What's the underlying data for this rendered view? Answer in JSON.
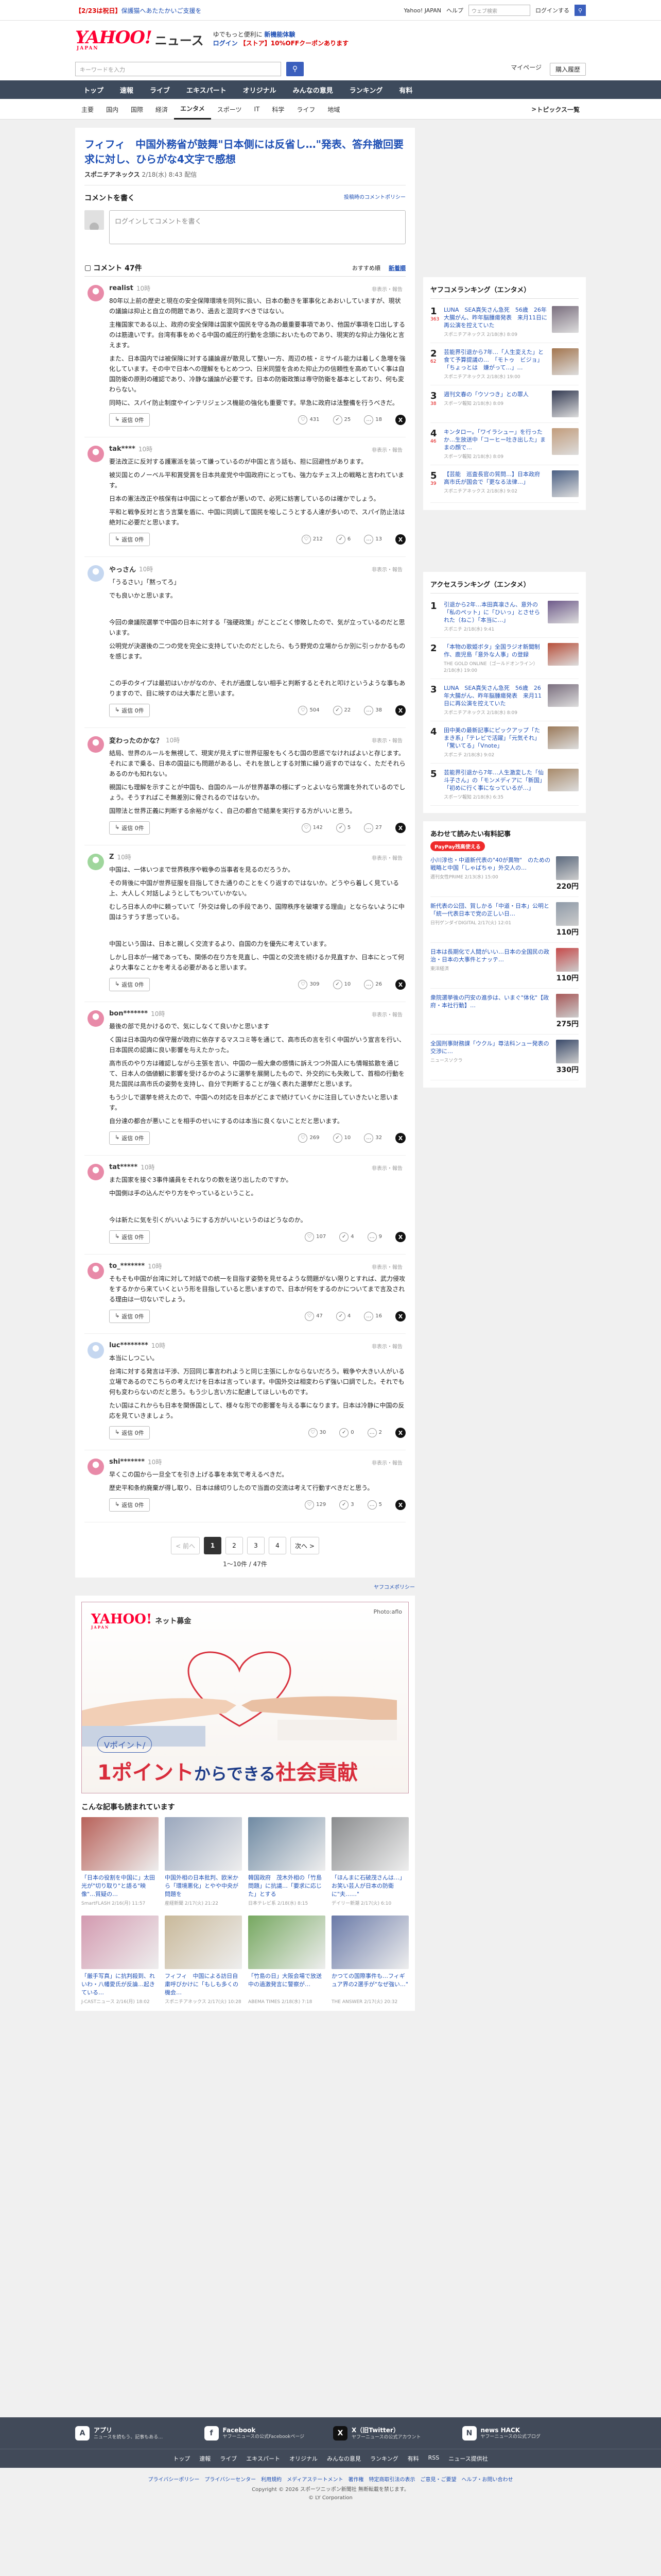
{
  "topstrip": {
    "notice_prefix": "【2/23は祝日】",
    "notice": "保護猫へあたたかいご支援を",
    "links": [
      "Yahoo! JAPAN",
      "ヘルプ"
    ],
    "search_placeholder": "ウェブ検索",
    "login_label": "ログインする"
  },
  "masthead": {
    "logo": "YAHOO!",
    "logo_sub": "JAPAN",
    "service": "ニュース",
    "promo_line1": "ゆでもっと便利に",
    "promo_line1b": "新機能体験",
    "promo_line2a": "ログイン",
    "promo_line2b": "【ストア】",
    "promo_line2c": "10%OFFクーポンあります"
  },
  "search": {
    "placeholder": "キーワードを入力",
    "links": [
      "マイページ",
      "購入履歴"
    ]
  },
  "nav": {
    "items": [
      "トップ",
      "速報",
      "ライブ",
      "エキスパート",
      "オリジナル",
      "みんなの意見",
      "ランキング",
      "有料"
    ]
  },
  "subnav": {
    "items": [
      "主要",
      "国内",
      "国際",
      "経済",
      "エンタメ",
      "スポーツ",
      "IT",
      "科学",
      "ライフ",
      "地域"
    ],
    "active": "エンタメ",
    "topics": "トピックス一覧"
  },
  "article": {
    "headline": "フィフィ　中国外務省が鼓舞\"日本側には反省し…\"発表、答弁撤回要求に対し、ひらがな4文字で感想",
    "source": "スポニチアネックス",
    "date": "2/18(水) 8:43 配信"
  },
  "comment_form": {
    "title": "コメントを書く",
    "policy": "投稿時のコメントポリシー",
    "placeholder": "ログインしてコメントを書く"
  },
  "comments_header": {
    "title": "コメント 47件",
    "sort_recommended": "おすすめ順",
    "sort_new": "新着順"
  },
  "comments": [
    {
      "user": "realist",
      "time": "10時",
      "report": "非表示・報告",
      "avatar_color": "#e88aa8",
      "body": [
        "80年以上前の歴史と現在の安全保障環境を同列に扱い、日本の動きを軍事化とあおいしていますが、現状の議論は抑止と自立の問題であり、過去と混同すべきではない。",
        "主権国家である以上、政府の安全保障は国家や国民を守る為の最重要事項であり、他国が事項を口出しするのは筋違いです。台湾有事をめぐる中国の威圧的行動を念頭においたものであり、現実的な抑止力強化と言えます。",
        "また、日本国内では被保険に対する議論遅が散見して整い一方、周辺の核・ミサイル能力は着しく急増を強化しています。その中で日本への理解をもとめつつ、日米同盟を含めた抑止力の信頼性を高めていく事は自国防衛の原則の確認であり、冷静な議論が必要です。日本の防衛政策は専守防衛を基本としており、何も変わらない。",
        "同時に、スパイ防止制度やインテリジェンス機能の強化も重要です。早急に政府は法整備を行うべきだ。"
      ],
      "reply": "返信 0件",
      "likes": "431",
      "think": "25",
      "hmm": "18"
    },
    {
      "user": "tak****",
      "time": "10時",
      "report": "非表示・報告",
      "avatar_color": "#e88aa8",
      "body": [
        "要法改正に反対する護憲派を装って嫌っているのが中国と言う話も、担に回避性があります。",
        "被災国とのノーベル平和賞受賞を日本共産党や中国政府にとっても、強力なチェス上の戦略と言われています。",
        "日本の憲法改正や核保有は中国にとって都合が悪いので、必死に妨害しているのは確かでしょう。",
        "平和と戦争反対と言う言葉を盾に、中国に同調して国民を唆しこうとする人達が多いので、スパイ防止法は絶対に必要だと思います。"
      ],
      "reply": "返信 0件",
      "likes": "212",
      "think": "6",
      "hmm": "13"
    },
    {
      "user": "やっさん",
      "time": "10時",
      "report": "非表示・報告",
      "avatar_color": "#c5d7f0",
      "body": [
        "「うるさい」「黙ってろ」",
        "でも良いかと思います。",
        "",
        "今回の衆議院選挙で中国の日本に対する「強硬政策」がことごとく惨敗したので、気が立っているのだと思います。",
        "公明党が決選後の二つの党を完全に支持していたのだとしたら、もう野党の立場からか別に引っかかるものを感じます。",
        "",
        "この手のタイプは最初はいかがなのか、それが過度しない相手と判断するとそれと叩けというような事もありますので、目に映すのは大事だと思います。"
      ],
      "reply": "返信 0件",
      "likes": "504",
      "think": "22",
      "hmm": "38"
    },
    {
      "user": "変わったのかな？",
      "time": "10時",
      "report": "非表示・報告",
      "avatar_color": "#e88aa8",
      "body": [
        "結局、世界のルールを無視して、現実が見えずに世界征服をもくろむ国の思惑でなければよいと存じます。それにまで乗る、日本の国益にも問題があるし、それを放しとする対策に繰り返すのではなく、ただそれらあるのかも知れない。",
        "親国にも理解を示すことが中国も、自国のルールが世界基準の様にずっとよいなら常識を外れているのでしょう。そうすればこそ無差別に脅されるのではないか。",
        "国際法と世界正義に判断する余裕がなく、自己の都合で結果を実行する方がいいと思う。"
      ],
      "reply": "返信 0件",
      "likes": "142",
      "think": "5",
      "hmm": "27"
    },
    {
      "user": "Z",
      "time": "10時",
      "report": "非表示・報告",
      "avatar_color": "#9fd69c",
      "body": [
        "中国は、一体いつまで世界秩序や戦争の当事者を見るのだろうか。",
        "その背後に中国が世界征服を目指してきた通りのことをくり返すのではないか。どうやら着しく見ている上、大人しく対話しようとしてもついていかない。",
        "むしろ日本人の中に頼っていて「外交は脅しの手段であり、国際秩序を破壊する理由」とならないように中国はうすうす思っている。",
        "",
        "中国という国は、日本と親しく交流するより、自国の力を優先に考えています。",
        "しかし日本が一緒であっても、関係の在り方を見直し、中国との交流を続けるか見直すか、日本にとって何より大事なことかを考える必要があると思います。"
      ],
      "reply": "返信 0件",
      "likes": "309",
      "think": "10",
      "hmm": "26"
    },
    {
      "user": "bon*******",
      "time": "10時",
      "report": "非表示・報告",
      "avatar_color": "#e88aa8",
      "body": [
        "最後の部で見かけるので、気にしなくて良いかと思います",
        "く国は日本国内の保守層が政府に依存するマスコミ等を通じて、高市氏の言を引く中国がいう宣言を行い、日本国民の認識に良い影響を与えたかった。",
        "高市氏のやり方は確認しながら主張を言い、中国の一般大衆の感情に訴えつつ外国人にも情報拡散を通じて、日本人の価値観に影響を受けるかのように選挙を展開したもので、外交的にも失敗して、首相の行動を見た国民は高市氏の姿勢を支持し、自分で判断することが強く表れた選挙だと思います。",
        "もう少しで選挙を終えたので、中国への対応を日本がどこまで続けていくかに注目していきたいと思います。",
        "自分達の都合が悪いことを相手のせいにするのは本当に良くないことだと思います。"
      ],
      "reply": "返信 0件",
      "likes": "269",
      "think": "10",
      "hmm": "32"
    },
    {
      "user": "tat*****",
      "time": "10時",
      "report": "非表示・報告",
      "avatar_color": "#e88aa8",
      "body": [
        "また国家を接ぐ3事件議員をそれなりの数を送り出したのですか。",
        "中国側は手の込んだやり方をやっているということ。",
        "",
        "今は新たに気を引くがいいようにする方がいいというのはどうなのか。"
      ],
      "reply": "返信 0件",
      "likes": "107",
      "think": "4",
      "hmm": "9"
    },
    {
      "user": "to_*******",
      "time": "10時",
      "report": "非表示・報告",
      "avatar_color": "#e88aa8",
      "body": [
        "そもそも中国が台湾に対して対話での統一を目指す姿勢を見せるような問題がない限りとすれば、武力侵攻をするかから来ていくという形を目指していると思いますので、日本が何をするのかについてまで言及される理由は一切ないでしょう。"
      ],
      "reply": "返信 0件",
      "likes": "47",
      "think": "4",
      "hmm": "16"
    },
    {
      "user": "luc********",
      "time": "10時",
      "report": "非表示・報告",
      "avatar_color": "#c5d7f0",
      "body": [
        "本当にしつこい。",
        "台湾に対する発言は干渉、万回同じ事言われようと同じ主張にしかならないだろう。戦争や大きい人がいる立場であるのでこちらの考えだけを日本は言っています。中国外交は相変わらず強い口調でした。それでも何も変わらないのだと思う。もう少し言い方に配慮してほしいものです。",
        "たい国はこれからも日本を関係国として、様々な形での影響を与える事になります。日本は冷静に中国の反応を見ていきましょう。"
      ],
      "reply": "返信 0件",
      "likes": "30",
      "think": "0",
      "hmm": "2"
    },
    {
      "user": "shi*******",
      "time": "10時",
      "report": "非表示・報告",
      "avatar_color": "#e88aa8",
      "body": [
        "早くこの国から一旦全てを引き上げる事を本気で考えるべきだ。",
        "歴史平和条約廃棄が得し取り、日本は縁切りしたので当面の交流は考えて行動すべきだと思う。"
      ],
      "reply": "返信 0件",
      "likes": "129",
      "think": "3",
      "hmm": "5"
    }
  ],
  "pager": {
    "prev": "< 前へ",
    "pages": [
      "1",
      "2",
      "3",
      "4"
    ],
    "next": "次へ >",
    "count": "1〜10件 / 47件"
  },
  "sponsor": "ヤフコメポリシー",
  "ad": {
    "logo": "YAHOO!",
    "logo_sub": "JAPAN",
    "service": "ネット募金",
    "credit": "Photo:aflo",
    "pill": "Vポイント/",
    "headline_a": "1ポイント",
    "headline_b": "からできる",
    "headline_c": "社会貢献"
  },
  "more": {
    "title": "こんな記事も読まれています",
    "items": [
      {
        "title": "「日本の役割を中国に」太田光が\"切り取り\"と語る\"映像\"…質疑の…",
        "src": "SmartFLASH",
        "date": "2/16(月) 11:57",
        "color": "#b8625a"
      },
      {
        "title": "中国外相の日本批判、欧米から「環境悪化」とやや中央が問題を",
        "src": "産経新聞",
        "date": "2/17(火) 21:22",
        "color": "#9aa7bd"
      },
      {
        "title": "韓国政府　茂木外相の「竹島問題」に抗議…「要求に応じた」とする",
        "src": "日本テレビ系",
        "date": "2/18(水) 8:15",
        "color": "#6f8aa3"
      },
      {
        "title": "「ほんまに石破茂さんは…」お笑い芸人が日本の防衛に\"夫……\"",
        "src": "デイリー新潮",
        "date": "2/17(火) 6:10",
        "color": "#8a8c8e"
      },
      {
        "title": "「厳手写真」に抗判殺到、れいわ・八幡愛氏が反論…起きている…",
        "src": "J-CASTニュース",
        "date": "2/16(月) 18:02",
        "color": "#d39ab0"
      },
      {
        "title": "フィフィ　中国による訪日自粛呼びかけに「もしも多くの機会…",
        "src": "スポニチアネックス",
        "date": "2/17(火) 10:28",
        "color": "#c9b99a"
      },
      {
        "title": "「竹島の日」大阪会場で放送中の過激発言に警察が…",
        "src": "ABEMA TIMES",
        "date": "2/18(水) 7:18",
        "color": "#76a860"
      },
      {
        "title": "かつての国際事件も…フィギュア界の2選手が\"なぜ強い…\"",
        "src": "THE ANSWER",
        "date": "2/17(火) 20:32",
        "color": "#6a7aa8"
      }
    ]
  },
  "sidebar": {
    "ranking_title": "ヤフコメランキング（エンタメ）",
    "ranking": [
      {
        "n": "1",
        "badge": "363",
        "title": "LUNA　SEA真矢さん急死　56歳　26年大腸がん、昨年脳腫瘍発表　来月11日に再公演を控えていた",
        "src": "スポニチアネックス",
        "date": "2/18(水) 8:09",
        "color": "#7a6e7e"
      },
      {
        "n": "2",
        "badge": "62",
        "title": "芸能界引退から7年…「人生変えた」と食て予算提議の…　「モトゥ　ビジョ」「ちょっとは　嫌がって…」…",
        "src": "スポニチアネックス",
        "date": "2/18(水) 19:00",
        "color": "#a3754e"
      },
      {
        "n": "3",
        "badge": "38",
        "title": "週刊文春の「ウソつき」との罪人",
        "src": "スポーツ報知",
        "date": "2/18(水) 8:09",
        "color": "#333a52"
      },
      {
        "n": "4",
        "badge": "46",
        "title": "キンタロー。「ワイラシュー」を行ったか…生放送中「コーヒー吐き出した」ままの顔で…",
        "src": "スポーツ報知",
        "date": "2/18(水) 8:09",
        "color": "#c29c7b"
      },
      {
        "n": "5",
        "badge": "39",
        "title": "【芸能　巡査長官の質問…】日本政府　高市氏が国会で「更なる法律…」",
        "src": "スポニチアネックス",
        "date": "2/18(水) 9:02",
        "color": "#4a5f83"
      }
    ],
    "access_title": "アクセスランキング（エンタメ）",
    "access": [
      {
        "n": "1",
        "title": "引退から2年…本田真凛さん、意外の「私のペット」に「ひいっ」とさせられた（ねこ）「本当に…」",
        "src": "スポニチ",
        "date": "2/18(水) 9:41",
        "color": "#6e5a8a"
      },
      {
        "n": "2",
        "title": "「本物の歌姫ボタ」全国ラジオ新聞制作、鹿児島「意外な人事」の登録",
        "src": "THE GOLD ONLINE（ゴールドオンライン）",
        "date": "2/18(水) 19:00",
        "color": "#b84f3a"
      },
      {
        "n": "3",
        "title": "LUNA　SEA真矢さん急死　56歳　26年大腸がん、昨年脳腫瘍発表　来月11日に再公演を控えていた",
        "src": "スポニチアネックス",
        "date": "2/18(水) 8:09",
        "color": "#7a6e7e"
      },
      {
        "n": "4",
        "title": "田中美の最新記事にピックアップ「たまき系」「テレビで活躍」「元気それ」「驚いてる」「Vnote」",
        "src": "スポニチ",
        "date": "2/18(水) 9:02",
        "color": "#9b7a5a"
      },
      {
        "n": "5",
        "title": "芸能界引退から7年…人生激変した「仙斗子さん」の「モンメディアに「新国」「初めに行く事になっているが…」",
        "src": "スポーツ報知",
        "date": "2/18(水) 6:35",
        "color": "#a88a6a"
      }
    ],
    "books_title": "あわせて読みたい有料記事",
    "paypay": "PayPay残高使える",
    "books": [
      {
        "title": "小川淳也・中道新代表の\"40が異物\"　のための戦略と中国「しゃばちゃ」外交人の…",
        "src": "週刊女性PRIME",
        "date": "2/13(水) 15:00",
        "price": "220円",
        "color": "#5c6a7e"
      },
      {
        "title": "新代表の公団、賀しかる「中道・日本」公明と「統一代表日本で党の正しい日…",
        "src": "日刊ゲンダイDIGITAL",
        "date": "2/17(火) 12:01",
        "price": "110円",
        "color": "#8e9aa8"
      },
      {
        "title": "日本は長期化で人間がいい…日本の全国民の政治・日本の大事件とナッテ…",
        "src": "東洋経済",
        "date": "",
        "price": "110円",
        "color": "#c74a4a"
      },
      {
        "title": "衆院選挙後の円安の進歩は、いまぐ\"体化\"【政府・本社行動】…",
        "src": "",
        "date": "",
        "price": "275円",
        "color": "#a85858"
      },
      {
        "title": "全国刑事財務課「ウクル」尊法科ンュー発表の交渉に…",
        "src": "ニュースソクラ",
        "date": "",
        "price": "330円",
        "color": "#3a4a6a"
      }
    ]
  },
  "footer": {
    "boxes": [
      {
        "icon": "A",
        "title": "アプリ",
        "desc": "ニュースを読もう、記事もある…"
      },
      {
        "icon": "f",
        "title": "Facebook",
        "desc": "ヤフーニュースの公式Facebookページ"
      },
      {
        "icon": "X",
        "title": "X（旧Twitter）",
        "desc": "ヤフーニュースの公式アカウント"
      },
      {
        "icon": "N",
        "title": "news HACK",
        "desc": "ヤフーニュースの公式ブログ"
      }
    ],
    "nav": [
      "トップ",
      "速報",
      "ライブ",
      "エキスパート",
      "オリジナル",
      "みんなの意見",
      "ランキング",
      "有料",
      "RSS",
      "ニュース提供社"
    ],
    "links": "プライバシーポリシー　プライバシーセンター　利用規約　メディアステートメント　著作権　特定商取引法の表示　ご意見・ご要望　ヘルプ・お問い合わせ",
    "copyright": "Copyright © 2026 スポーツニッポン新聞社 無断転載を禁じます。",
    "corp": "© LY Corporation"
  }
}
